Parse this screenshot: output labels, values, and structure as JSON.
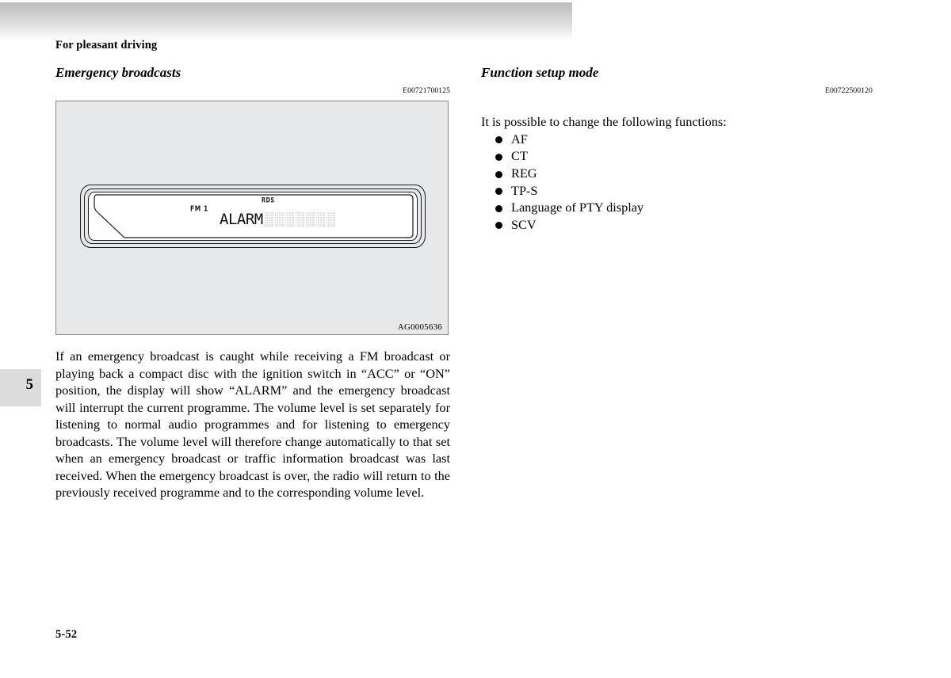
{
  "page": {
    "running_head": "For pleasant driving",
    "folio": "5-52",
    "chapter_tab_number": "5"
  },
  "left_column": {
    "section_title": "Emergency broadcasts",
    "reference_code": "E00721700125",
    "figure": {
      "caption": "AG0005636",
      "radio_display": {
        "band_label": "FM 1",
        "rds_label": "RDS",
        "main_text": "ALARM",
        "blank_cells": 7
      }
    },
    "body_text": "If an emergency broadcast is caught while receiving a FM broadcast or playing back a compact disc with the ignition switch in “ACC” or “ON” position, the display will show “ALARM” and the emergency broadcast will interrupt the current programme. The volume level is set separately for listening to normal audio programmes and for listening to emergency broadcasts. The volume level will therefore change automatically to that set when an emergency broadcast or traffic information broadcast was last received. When the emergency broadcast is over, the radio will return to the previously received programme and to the corresponding volume level."
  },
  "right_column": {
    "section_title": "Function setup mode",
    "reference_code": "E00722500120",
    "intro_text": "It is possible to change the following functions:",
    "function_items": [
      {
        "label": "AF"
      },
      {
        "label": "CT"
      },
      {
        "label": "REG"
      },
      {
        "label": "TP-S"
      },
      {
        "label": "Language of PTY display"
      },
      {
        "label": "SCV"
      }
    ]
  },
  "colors": {
    "page_background": "#ffffff",
    "header_band_top": "#bcbcbc",
    "figure_fill": "#e7e8e9",
    "figure_border": "#8a8a8a",
    "chapter_tab_fill": "#dcdcdc",
    "lcd_blank_cell": "#e0e0e0",
    "text": "#000000"
  }
}
